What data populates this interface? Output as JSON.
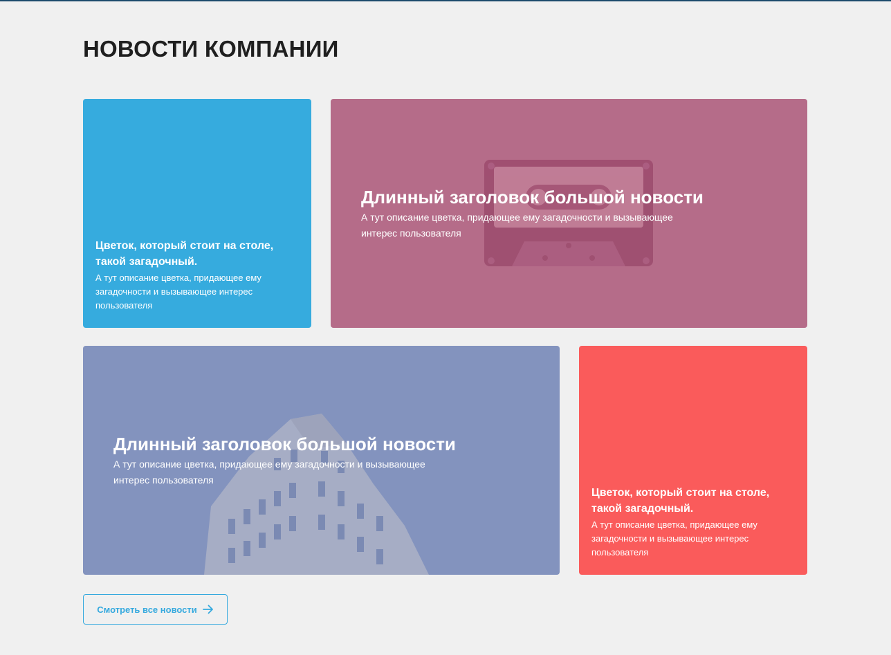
{
  "section": {
    "title": "НОВОСТИ КОМПАНИИ"
  },
  "colors": {
    "top_line": "#1c4a6b",
    "card_blue": "#36abde",
    "card_pink": "#b56c89",
    "card_slate": "#8393be",
    "card_red": "#fa5b5b",
    "accent": "#35a9de"
  },
  "cards": [
    {
      "heading": "Цветок, который стоит на столе, такой загадочный.",
      "description": "А тут описание цветка, придающее ему загадочности и вызывающее интерес пользователя",
      "background": "solid-blue"
    },
    {
      "heading": "Длинный заголовок большой новости",
      "description": "А тут описание цветка, придающее ему загадочности и вызывающее интерес пользователя",
      "background": "cassette-tape-photo"
    },
    {
      "heading": "Длинный заголовок большой новости",
      "description": "А тут описание цветка, придающее ему загадочности и вызывающее интерес пользователя",
      "background": "building-photo"
    },
    {
      "heading": "Цветок, который стоит на столе, такой загадочный.",
      "description": "А тут описание цветка, придающее ему загадочности и вызывающее интерес пользователя",
      "background": "solid-red"
    }
  ],
  "all_news_button": {
    "label": "Смотреть все новости",
    "icon": "arrow-right-icon"
  }
}
